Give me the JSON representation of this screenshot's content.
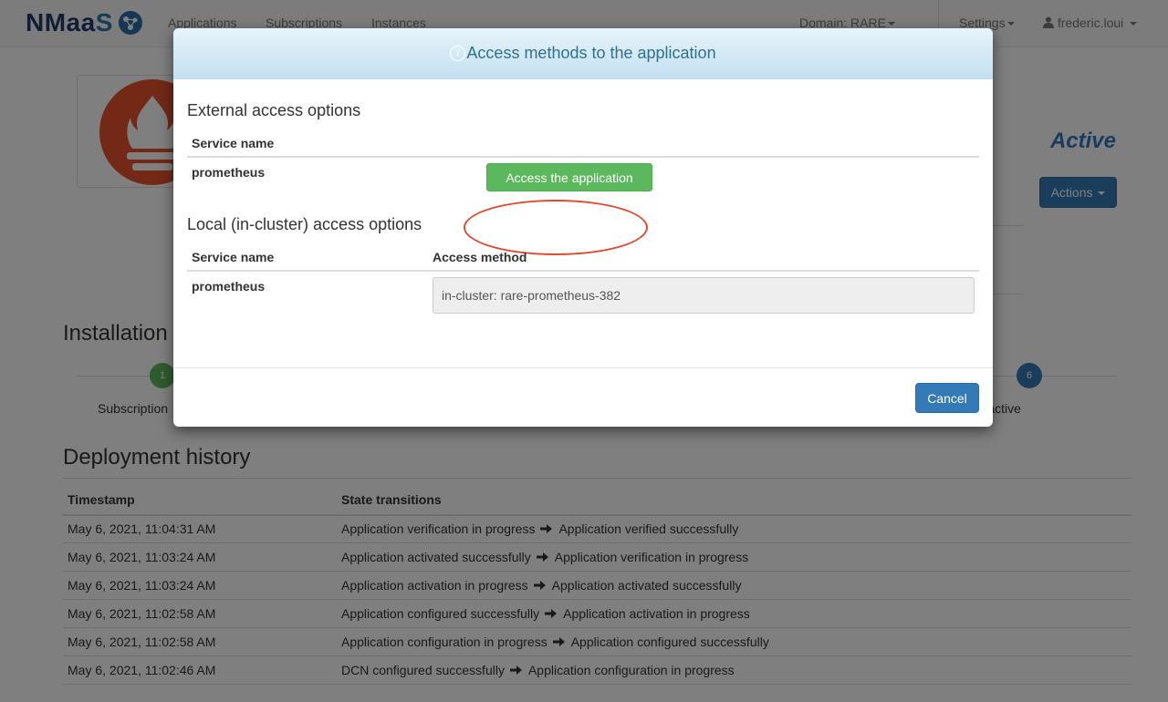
{
  "navbar": {
    "brand_main": "NMaa",
    "brand_tail": "S",
    "links": [
      "Applications",
      "Subscriptions",
      "Instances"
    ],
    "domain_label": "Domain: RARE",
    "settings_label": "Settings",
    "user_label": "frederic.loui"
  },
  "page": {
    "status": "Active",
    "actions_label": "Actions",
    "install_heading": "Installation",
    "steps": [
      {
        "number": "1",
        "label": "Subscription"
      },
      {
        "number": "6",
        "label": "Application active"
      }
    ],
    "deploy_heading": "Deployment history",
    "history_headers": [
      "Timestamp",
      "State transitions"
    ],
    "history_rows": [
      {
        "ts": "May 6, 2021, 11:04:31 AM",
        "from": "Application verification in progress",
        "to": "Application verified successfully"
      },
      {
        "ts": "May 6, 2021, 11:03:24 AM",
        "from": "Application activated successfully",
        "to": "Application verification in progress"
      },
      {
        "ts": "May 6, 2021, 11:03:24 AM",
        "from": "Application activation in progress",
        "to": "Application activated successfully"
      },
      {
        "ts": "May 6, 2021, 11:02:58 AM",
        "from": "Application configured successfully",
        "to": "Application activation in progress"
      },
      {
        "ts": "May 6, 2021, 11:02:58 AM",
        "from": "Application configuration in progress",
        "to": "Application configured successfully"
      },
      {
        "ts": "May 6, 2021, 11:02:46 AM",
        "from": "DCN configured successfully",
        "to": "Application configuration in progress"
      }
    ]
  },
  "modal": {
    "title": "Access methods to the application",
    "external": {
      "title": "External access options",
      "header_service": "Service name",
      "service": "prometheus",
      "button_label": "Access the application"
    },
    "local": {
      "title": "Local (in-cluster) access options",
      "header_service": "Service name",
      "header_method": "Access method",
      "service": "prometheus",
      "method_value": "in-cluster: rare-prometheus-382"
    },
    "cancel_label": "Cancel"
  },
  "colors": {
    "primary": "#337ab7",
    "success": "#5cb85c",
    "status_active": "#2e7bc0",
    "highlight_ring": "#e04a2e",
    "prometheus_logo": "#e6522c"
  },
  "icons": [
    "nmaas-logo-icon",
    "user-icon",
    "prometheus-logo-icon",
    "info-icon",
    "arrow-right-icon"
  ]
}
